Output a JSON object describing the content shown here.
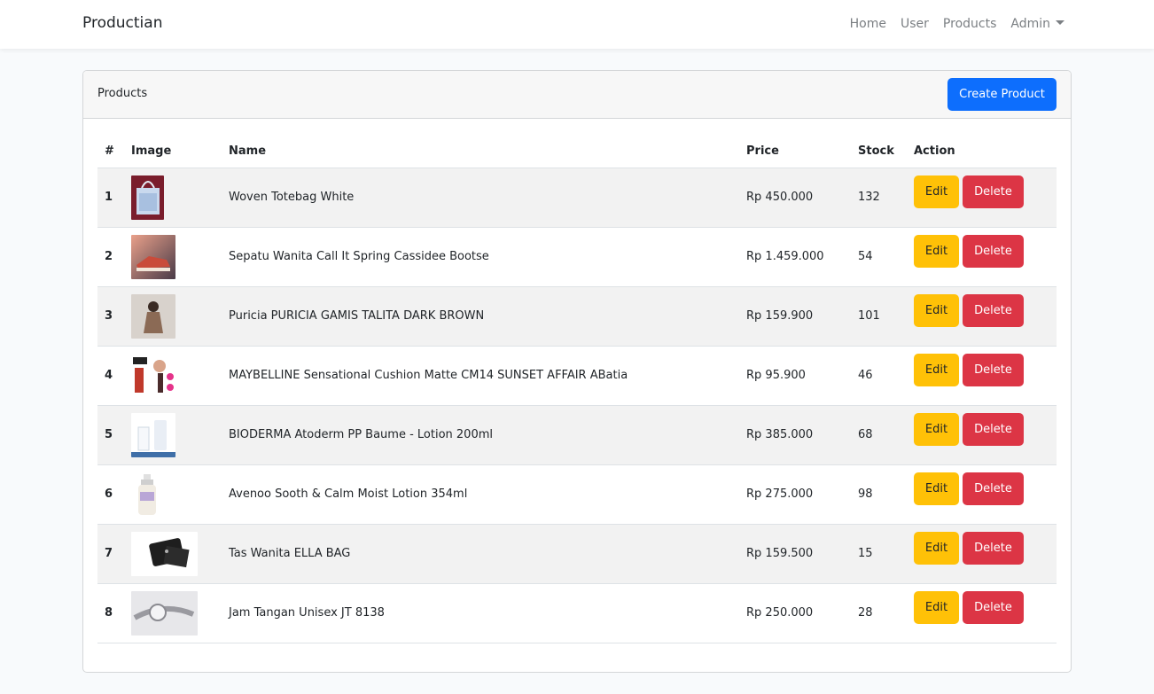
{
  "navbar": {
    "brand": "Productian",
    "links": [
      "Home",
      "User",
      "Products",
      "Admin"
    ]
  },
  "card": {
    "title": "Products",
    "create_button": "Create Product"
  },
  "table": {
    "headers": [
      "#",
      "Image",
      "Name",
      "Price",
      "Stock",
      "Action"
    ],
    "edit_label": "Edit",
    "delete_label": "Delete",
    "rows": [
      {
        "no": "1",
        "name": "Woven Totebag White",
        "price": "Rp 450.000",
        "stock": "132",
        "image": "tote-bag-photo"
      },
      {
        "no": "2",
        "name": "Sepatu Wanita Call It Spring Cassidee Bootse",
        "price": "Rp 1.459.000",
        "stock": "54",
        "image": "sneaker-photo"
      },
      {
        "no": "3",
        "name": "Puricia PURICIA GAMIS TALITA DARK BROWN",
        "price": "Rp 159.900",
        "stock": "101",
        "image": "dress-photo"
      },
      {
        "no": "4",
        "name": "MAYBELLINE Sensational Cushion Matte CM14 SUNSET AFFAIR ABatia",
        "price": "Rp 95.900",
        "stock": "46",
        "image": "lipstick-photo"
      },
      {
        "no": "5",
        "name": "BIODERMA Atoderm PP Baume - Lotion 200ml",
        "price": "Rp 385.000",
        "stock": "68",
        "image": "lotion-tube-photo"
      },
      {
        "no": "6",
        "name": "Avenoo Sooth & Calm Moist Lotion 354ml",
        "price": "Rp 275.000",
        "stock": "98",
        "image": "lotion-bottle-photo"
      },
      {
        "no": "7",
        "name": "Tas Wanita ELLA BAG",
        "price": "Rp 159.500",
        "stock": "15",
        "image": "black-bag-photo"
      },
      {
        "no": "8",
        "name": "Jam Tangan Unisex JT 8138",
        "price": "Rp 250.000",
        "stock": "28",
        "image": "watch-photo"
      }
    ]
  }
}
